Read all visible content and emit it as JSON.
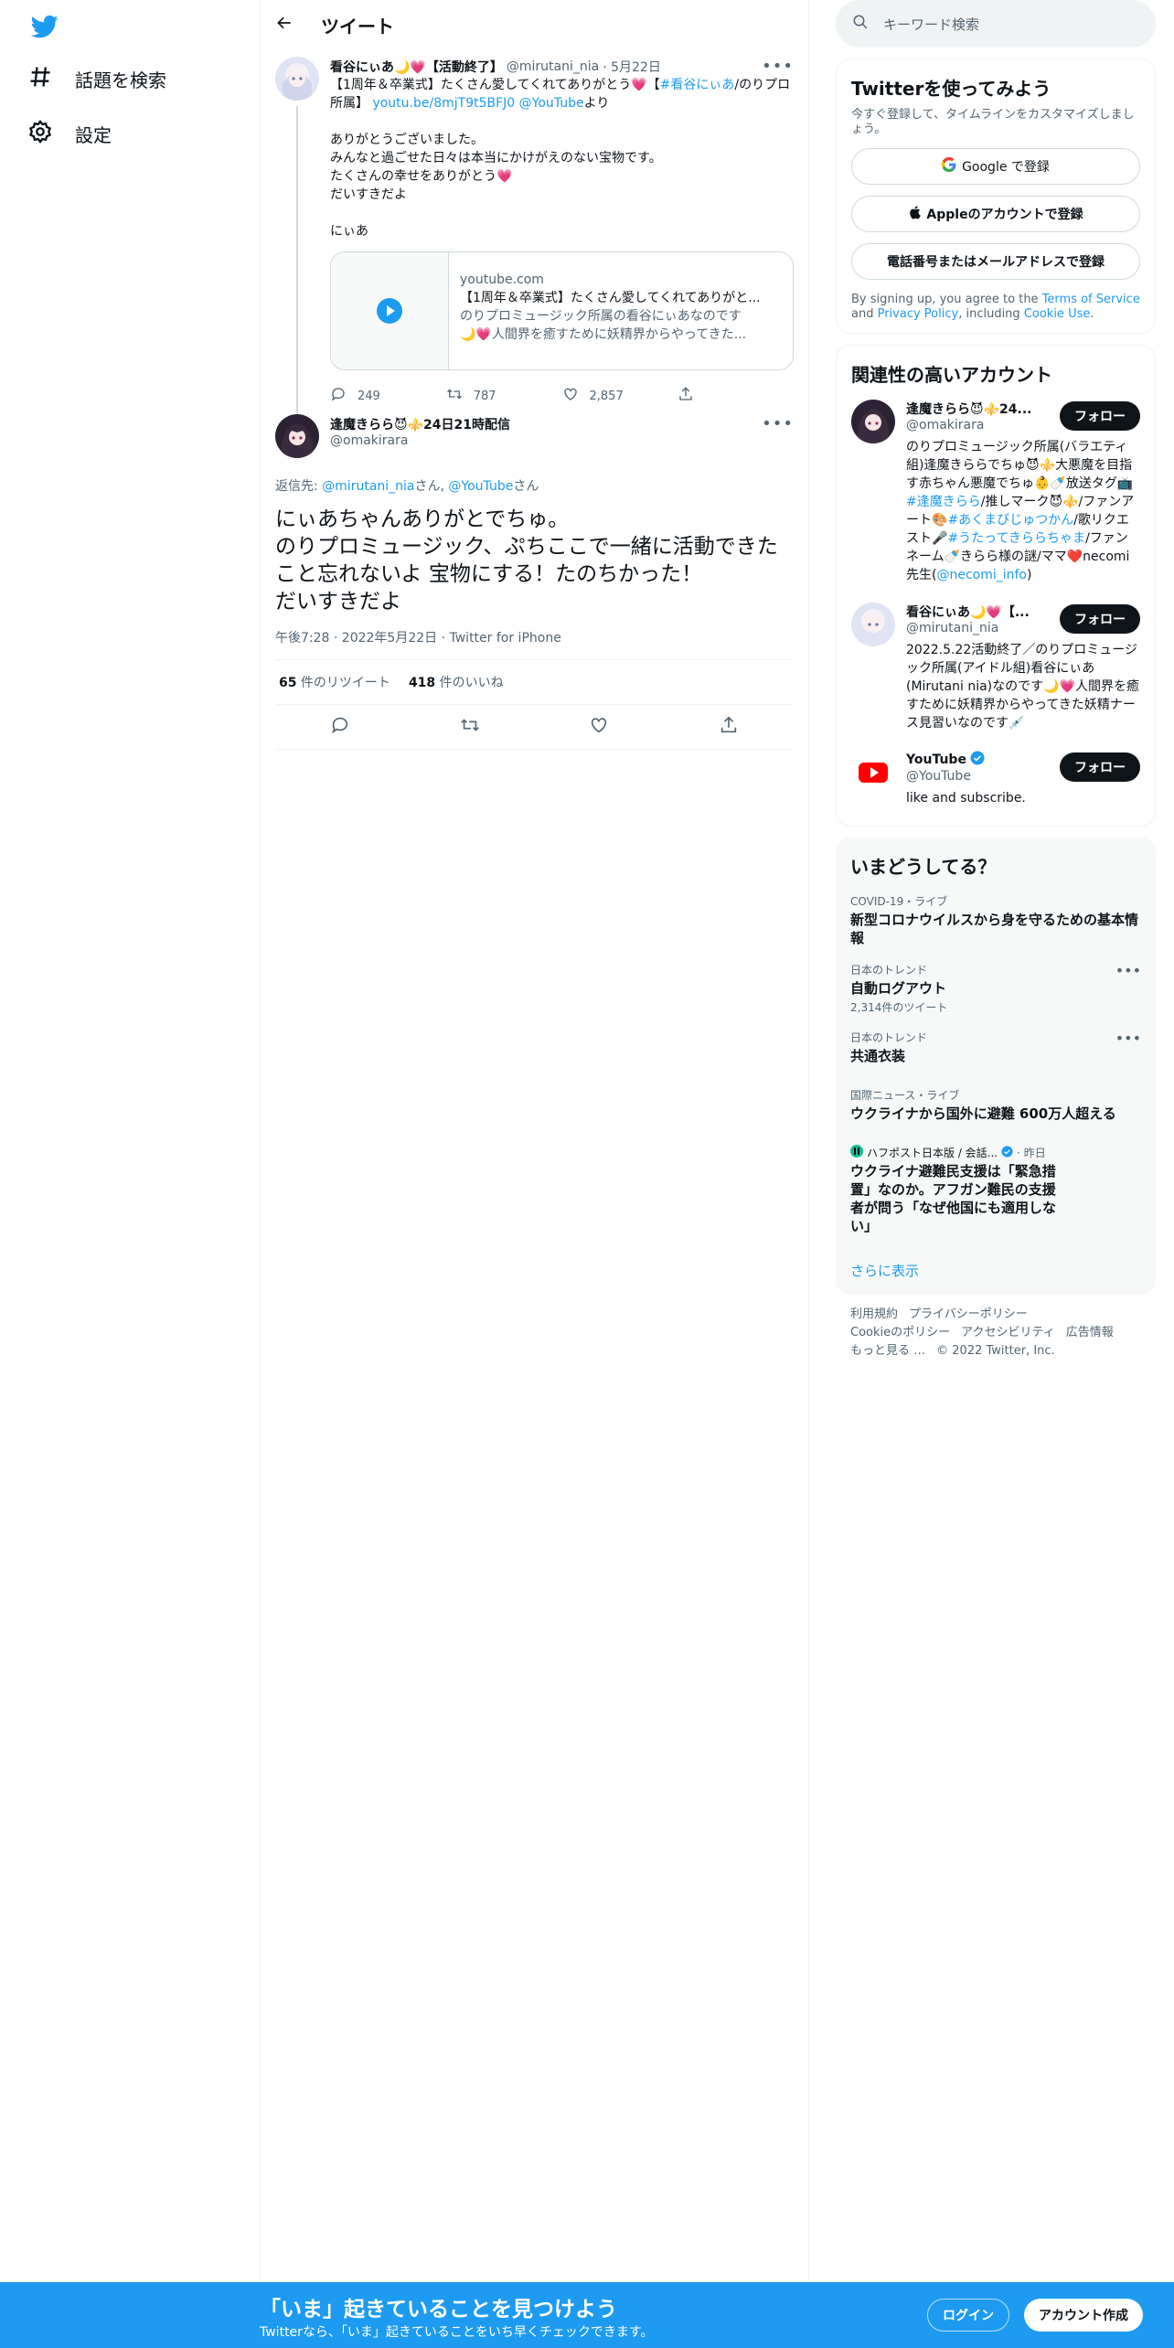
{
  "colors": {
    "accent": "#1d9bf0",
    "text": "#0f1419",
    "muted": "#536471"
  },
  "nav": {
    "logo": "twitter-bird-icon",
    "items": [
      {
        "label": "話題を検索",
        "icon": "hashtag-icon"
      },
      {
        "label": "設定",
        "icon": "gear-icon"
      }
    ]
  },
  "header": {
    "title": "ツイート"
  },
  "parent_tweet": {
    "name": "看谷にぃあ🌙💗【活動終了】",
    "handle": "@mirutani_nia",
    "date": "· 5月22日",
    "text_1": "【1周年＆卒業式】たくさん愛してくれてありがとう💗【",
    "hashtag": "#看谷にぃあ",
    "text_2": "/のりプロ所属】 ",
    "link": "youtu.be/8mjT9t5BFJ0",
    "mention": "@YouTube",
    "text_3": "より",
    "body": "ありがとうございました。\nみんなと過ごせた日々は本当にかけがえのない宝物です。\nたくさんの幸せをありがとう💗\nだいすきだよ\n\nにぃあ",
    "card": {
      "domain": "youtube.com",
      "title": "【1周年＆卒業式】たくさん愛してくれてありがと...",
      "desc_1": "のりプロミュージック所属の看谷にぃあなのです",
      "desc_2": "🌙💗人間界を癒すために妖精界からやってきた..."
    },
    "replies": "249",
    "retweets": "787",
    "likes": "2,857"
  },
  "main_tweet": {
    "name": "逢魔きらら😈⚜️24日21時配信",
    "handle": "@omakirara",
    "reply_prefix": "返信先: ",
    "reply_to_1": "@mirutani_nia",
    "reply_mid": "さん, ",
    "reply_to_2": "@YouTube",
    "reply_suffix": "さん",
    "text": "にぃあちゃんありがとでちゅ。\nのりプロミュージック、ぷちここで一緒に活動できたこと忘れないよ 宝物にする！たのちかった！\nだいすきだよ",
    "time": "午後7:28 · 2022年5月22日 · Twitter for iPhone",
    "retweet_count": "65",
    "retweet_label": " 件のリツイート",
    "like_count": "418",
    "like_label": " 件のいいね"
  },
  "search": {
    "placeholder": "キーワード検索"
  },
  "signup_panel": {
    "title": "Twitterを使ってみよう",
    "subtitle": "今すぐ登録して、タイムラインをカスタマイズしましょう。",
    "google": "Google で登録",
    "apple": "Appleのアカウントで登録",
    "phone": "電話番号またはメールアドレスで登録",
    "terms_1": "By signing up, you agree to the ",
    "terms_link": "Terms of Service",
    "terms_2": " and ",
    "privacy_link": "Privacy Policy",
    "terms_3": ", including ",
    "cookie_link": "Cookie Use",
    "terms_4": "."
  },
  "related": {
    "title": "関連性の高いアカウント",
    "follow": "フォロー",
    "accounts": [
      {
        "name": "逢魔きらら😈⚜️24...",
        "handle": "@omakirara",
        "bio_1": "のりプロミュージック所属(バラエティ組)逢魔きららでちゅ😈⚜️大悪魔を目指す赤ちゃん悪魔でちゅ👶🍼放送タグ📺",
        "bio_tag_1": "#逢魔きらら",
        "bio_2": "/推しマーク😈⚜️/ファンアート🎨",
        "bio_tag_2": "#あくまびじゅつかん",
        "bio_3": "/歌リクエスト🎤",
        "bio_tag_3": "#うたってきららちゃま",
        "bio_4": "/ファンネーム🍼きらら様の謎/ママ❤️necomi先生(",
        "bio_link": "@necomi_info",
        "bio_5": ")"
      },
      {
        "name": "看谷にぃあ🌙💗【...",
        "handle": "@mirutani_nia",
        "bio": "2022.5.22活動終了／のりプロミュージック所属(アイドル組)看谷にぃあ(Mirutani nia)なのです🌙💗人間界を癒すために妖精界からやってきた妖精ナース見習いなのです💉"
      },
      {
        "name": "YouTube",
        "handle": "@YouTube",
        "bio": "like and subscribe."
      }
    ]
  },
  "trends": {
    "title": "いまどうしてる？",
    "items": [
      {
        "category": "COVID-19・ライブ",
        "title": "新型コロナウイルスから身を守るための基本情報",
        "count": ""
      },
      {
        "category": "日本のトレンド",
        "title": "自動ログアウト",
        "count": "2,314件のツイート"
      },
      {
        "category": "日本のトレンド",
        "title": "共通衣装",
        "count": ""
      },
      {
        "category": "国際ニュース・ライブ",
        "title": "ウクライナから国外に避難 600万人超える",
        "count": ""
      },
      {
        "category": "ハフポスト日本版 / 会話...",
        "category_suffix": " · 昨日",
        "title": "ウクライナ避難民支援は「緊急措置」なのか。アフガン難民の支援者が問う「なぜ他国にも適用しない」",
        "count": ""
      }
    ],
    "show_more": "さらに表示"
  },
  "footer": {
    "links": [
      "利用規約",
      "プライバシーポリシー",
      "Cookieのポリシー",
      "アクセシビリティ",
      "広告情報",
      "もっと見る …",
      "© 2022 Twitter, Inc."
    ]
  },
  "bottom_bar": {
    "title": "「いま」起きていることを見つけよう",
    "subtitle": "Twitterなら、「いま」起きていることをいち早くチェックできます。",
    "login": "ログイン",
    "signup": "アカウント作成"
  }
}
